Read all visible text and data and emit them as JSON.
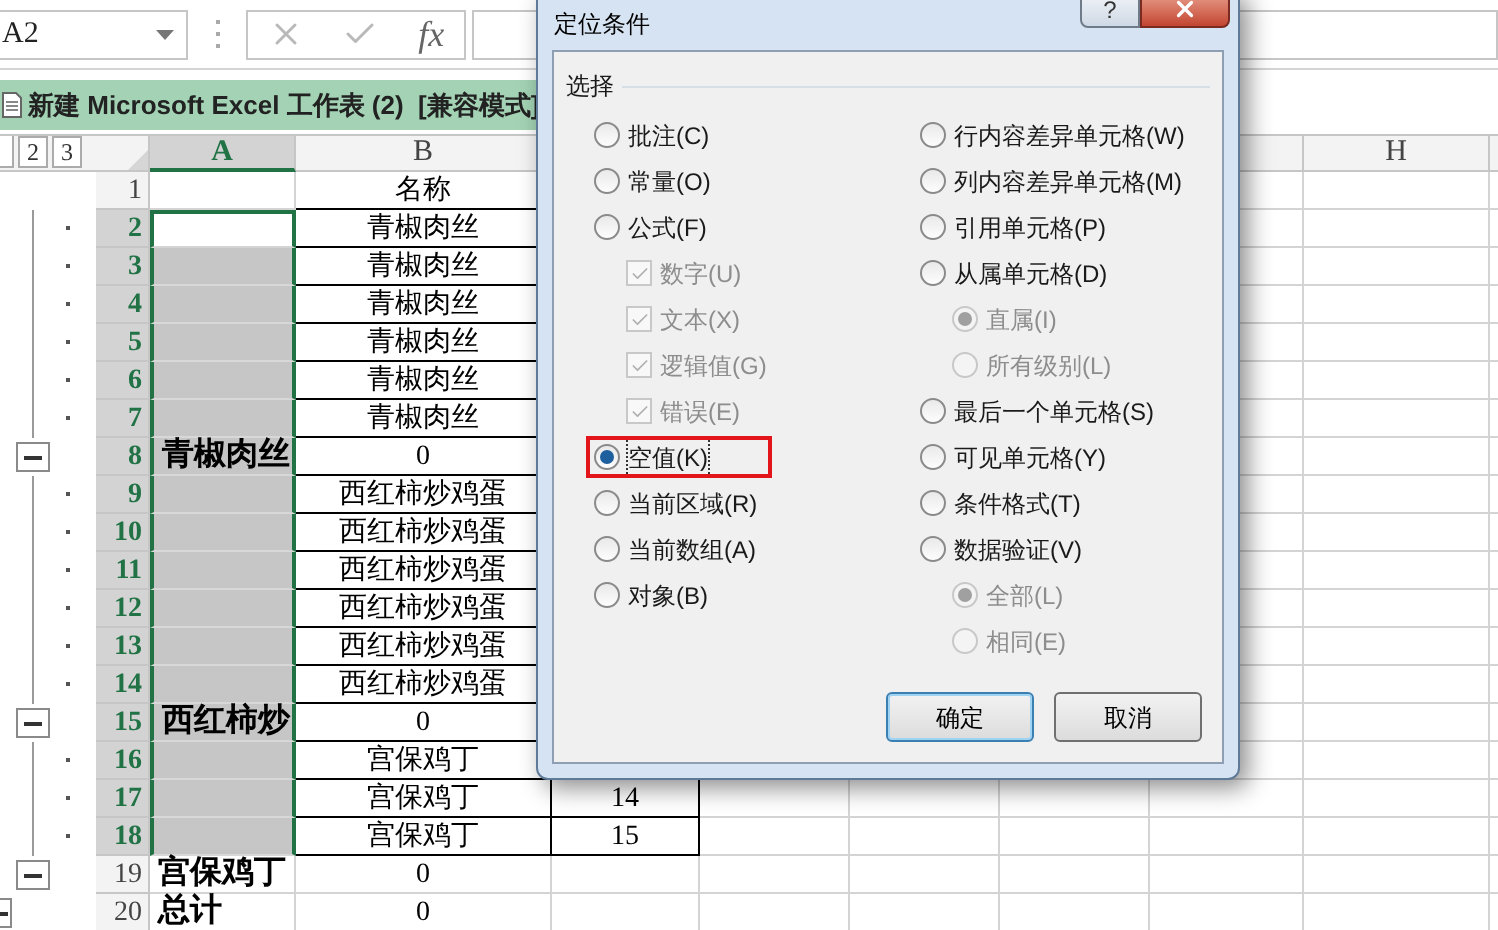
{
  "formula_bar": {
    "name_box": "A2",
    "function_label": "fx"
  },
  "workbook": {
    "title": "新建 Microsoft Excel 工作表 (2)  [兼容模式]"
  },
  "outline_levels": [
    "2",
    "3"
  ],
  "columns": [
    {
      "label": "A",
      "selected": true
    },
    {
      "label": "B",
      "selected": false
    },
    {
      "label": "H",
      "selected": false
    }
  ],
  "rows": [
    {
      "number": "1",
      "selected": false,
      "kind": "none",
      "table": true,
      "b": "名称"
    },
    {
      "number": "2",
      "selected": true,
      "active": true,
      "kind": "dot",
      "table": true,
      "b": "青椒肉丝"
    },
    {
      "number": "3",
      "selected": true,
      "kind": "dot",
      "table": true,
      "b": "青椒肉丝"
    },
    {
      "number": "4",
      "selected": true,
      "kind": "dot",
      "table": true,
      "b": "青椒肉丝"
    },
    {
      "number": "5",
      "selected": true,
      "kind": "dot",
      "table": true,
      "b": "青椒肉丝"
    },
    {
      "number": "6",
      "selected": true,
      "kind": "dot",
      "table": true,
      "b": "青椒肉丝"
    },
    {
      "number": "7",
      "selected": true,
      "kind": "dot",
      "table": true,
      "b": "青椒肉丝"
    },
    {
      "number": "8",
      "selected": true,
      "kind": "collapse",
      "table": true,
      "a": "青椒肉丝",
      "b": "0"
    },
    {
      "number": "9",
      "selected": true,
      "kind": "dot",
      "table": true,
      "b": "西红柿炒鸡蛋"
    },
    {
      "number": "10",
      "selected": true,
      "kind": "dot",
      "table": true,
      "b": "西红柿炒鸡蛋"
    },
    {
      "number": "11",
      "selected": true,
      "kind": "dot",
      "table": true,
      "b": "西红柿炒鸡蛋"
    },
    {
      "number": "12",
      "selected": true,
      "kind": "dot",
      "table": true,
      "b": "西红柿炒鸡蛋"
    },
    {
      "number": "13",
      "selected": true,
      "kind": "dot",
      "table": true,
      "b": "西红柿炒鸡蛋"
    },
    {
      "number": "14",
      "selected": true,
      "kind": "dot",
      "table": true,
      "b": "西红柿炒鸡蛋"
    },
    {
      "number": "15",
      "selected": true,
      "kind": "collapse",
      "table": true,
      "a": "西红柿炒",
      "b": "0"
    },
    {
      "number": "16",
      "selected": true,
      "kind": "dot",
      "table": true,
      "b": "宫保鸡丁"
    },
    {
      "number": "17",
      "selected": true,
      "kind": "dot",
      "table": true,
      "b": "宫保鸡丁",
      "c": "14"
    },
    {
      "number": "18",
      "selected": true,
      "kind": "dot",
      "table": true,
      "b": "宫保鸡丁",
      "c": "15"
    },
    {
      "number": "19",
      "selected": false,
      "kind": "collapse",
      "table": false,
      "a": "宫保鸡丁",
      "b": "0"
    },
    {
      "number": "20",
      "selected": false,
      "kind": "collapse_outer",
      "table": false,
      "a": "总计",
      "b": "0"
    }
  ],
  "dialog": {
    "title": "定位条件",
    "help": "?",
    "group": "选择",
    "left": [
      {
        "kind": "radio",
        "label": "批注(C)",
        "selected": false,
        "disabled": false
      },
      {
        "kind": "radio",
        "label": "常量(O)",
        "selected": false,
        "disabled": false
      },
      {
        "kind": "radio",
        "label": "公式(F)",
        "selected": false,
        "disabled": false,
        "children": [
          {
            "kind": "checkbox",
            "label": "数字(U)",
            "checked": true,
            "disabled": true
          },
          {
            "kind": "checkbox",
            "label": "文本(X)",
            "checked": true,
            "disabled": true
          },
          {
            "kind": "checkbox",
            "label": "逻辑值(G)",
            "checked": true,
            "disabled": true
          },
          {
            "kind": "checkbox",
            "label": "错误(E)",
            "checked": true,
            "disabled": true
          }
        ]
      },
      {
        "kind": "radio",
        "label": "空值(K)",
        "selected": true,
        "disabled": false,
        "highlighted": true
      },
      {
        "kind": "radio",
        "label": "当前区域(R)",
        "selected": false,
        "disabled": false
      },
      {
        "kind": "radio",
        "label": "当前数组(A)",
        "selected": false,
        "disabled": false
      },
      {
        "kind": "radio",
        "label": "对象(B)",
        "selected": false,
        "disabled": false
      }
    ],
    "right": [
      {
        "kind": "radio",
        "label": "行内容差异单元格(W)",
        "selected": false,
        "disabled": false
      },
      {
        "kind": "radio",
        "label": "列内容差异单元格(M)",
        "selected": false,
        "disabled": false
      },
      {
        "kind": "radio",
        "label": "引用单元格(P)",
        "selected": false,
        "disabled": false
      },
      {
        "kind": "radio",
        "label": "从属单元格(D)",
        "selected": false,
        "disabled": false,
        "children": [
          {
            "kind": "radio",
            "label": "直属(I)",
            "selected": true,
            "disabled": true
          },
          {
            "kind": "radio",
            "label": "所有级别(L)",
            "selected": false,
            "disabled": true
          }
        ]
      },
      {
        "kind": "radio",
        "label": "最后一个单元格(S)",
        "selected": false,
        "disabled": false
      },
      {
        "kind": "radio",
        "label": "可见单元格(Y)",
        "selected": false,
        "disabled": false
      },
      {
        "kind": "radio",
        "label": "条件格式(T)",
        "selected": false,
        "disabled": false
      },
      {
        "kind": "radio",
        "label": "数据验证(V)",
        "selected": false,
        "disabled": false,
        "children": [
          {
            "kind": "radio",
            "label": "全部(L)",
            "selected": true,
            "disabled": true
          },
          {
            "kind": "radio",
            "label": "相同(E)",
            "selected": false,
            "disabled": true
          }
        ]
      }
    ],
    "buttons": [
      {
        "label": "确定",
        "default": true
      },
      {
        "label": "取消",
        "default": false
      }
    ]
  }
}
